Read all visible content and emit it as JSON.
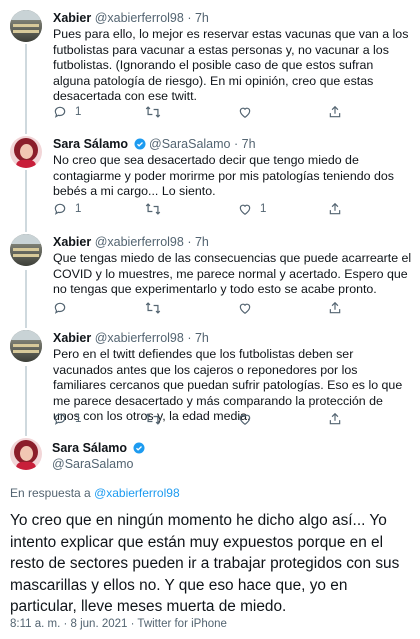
{
  "tweets": [
    {
      "name": "Xabier",
      "handle": "@xabierferrol98",
      "sep": "·",
      "time": "7h",
      "text": "Pues para ello, lo mejor es reservar estas vacunas que van a los futbolistas para vacunar a estas personas y, no vacunar a los futbolistas. (Ignorando el posible caso de que estos sufran alguna patología de riesgo). En mi opinión, creo que estas desacertada con ese twitt.",
      "replies": "1",
      "retweets": "",
      "likes": ""
    },
    {
      "name": "Sara Sálamo",
      "handle": "@SaraSalamo",
      "sep": "·",
      "time": "7h",
      "text": "No creo que sea desacertado decir que tengo miedo de contagiarme y poder morirme por mis patologías teniendo dos bebés a mi cargo... Lo siento.",
      "replies": "1",
      "retweets": "",
      "likes": "1"
    },
    {
      "name": "Xabier",
      "handle": "@xabierferrol98",
      "sep": "·",
      "time": "7h",
      "text": "Que tengas miedo de las consecuencias que puede acarrearte el COVID y lo muestres, me parece normal y acertado. Espero que no tengas que experimentarlo y todo esto se acabe pronto.",
      "replies": "",
      "retweets": "",
      "likes": ""
    },
    {
      "name": "Xabier",
      "handle": "@xabierferrol98",
      "sep": "·",
      "time": "7h",
      "text": "Pero en el twitt defiendes que los futbolistas deben ser vacunados antes que los cajeros o reponedores por los familiares cercanos que puedan sufrir patologías. Eso es lo que me parece desacertado y más comparando la protección de unos con los otros y, la edad media.",
      "replies": "1",
      "retweets": "",
      "likes": ""
    }
  ],
  "main": {
    "name": "Sara Sálamo",
    "handle": "@SaraSalamo",
    "reply_prefix": "En respuesta a",
    "reply_handle": "@xabierferrol98",
    "text": "Yo creo que en ningún momento he dicho algo así... Yo intento explicar que están muy expuestos porque en el resto de sectores pueden ir a trabajar protegidos con sus mascarillas y ellos no. Y que eso hace que, yo en particular, lleve meses muerta de miedo.",
    "footer": "8:11 a. m. · 8 jun. 2021 · Twitter for iPhone"
  },
  "icons": {
    "reply": "reply-icon",
    "retweet": "retweet-icon",
    "like": "heart-icon",
    "share": "share-icon",
    "verified": "verified-badge-icon"
  },
  "colors": {
    "accent": "#1d9bf0",
    "muted": "#536471",
    "thread_line": "#cfd9de"
  }
}
